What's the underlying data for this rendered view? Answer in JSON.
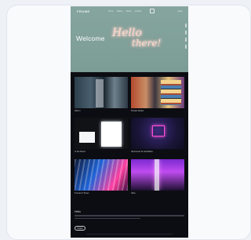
{
  "site": {
    "logo": "FRAME",
    "nav_items": [
      "Home",
      "Gallery",
      "Works",
      "Contact"
    ],
    "nav_right": "Menu"
  },
  "hero": {
    "title": "Welcome",
    "neon_line1": "Hello",
    "neon_line2": "there!"
  },
  "gallery": [
    {
      "caption": "Album"
    },
    {
      "caption": "Private Studio"
    },
    {
      "caption": "In the Room"
    },
    {
      "caption": "Vancouver Art Exhibition"
    },
    {
      "caption": "Tunnel of Tones"
    },
    {
      "caption": "Ultra"
    }
  ],
  "footer": {
    "title": "Hello",
    "button_label": "Follow"
  },
  "colors": {
    "hero_bg": "#7c9c96",
    "page_bg": "#0c0d12",
    "neon": "#ffd4c7"
  }
}
